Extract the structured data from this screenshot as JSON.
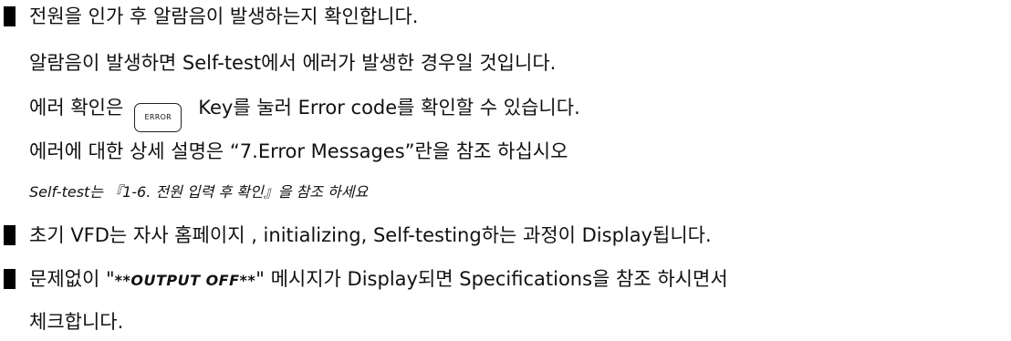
{
  "doc": {
    "l1": "전원을 인가 후 알람음이 발생하는지 확인합니다.",
    "l2": "알람음이 발생하면 Self-test에서 에러가 발생한 경우일 것입니다.",
    "l3_before": "에러 확인은",
    "l3_key": "ERROR",
    "l3_after": "Key를 눌러 Error code를 확인할 수 있습니다.",
    "l4": "에러에 대한 상세 설명은 “7.Error Messages”란을 참조 하십시오",
    "l5": "Self-test는 『1-6. 전원 입력 후 확인』을 참조 하세요",
    "l6": "초기 VFD는 자사 홈페이지 , initializing, Self-testing하는 과정이 Display됩니다.",
    "l7_before": "문제없이 \"",
    "l7_code": "**OUTPUT OFF**",
    "l7_after": "\" 메시지가 Display되면 Specifications을 참조 하시면서",
    "l8": "체크합니다."
  }
}
